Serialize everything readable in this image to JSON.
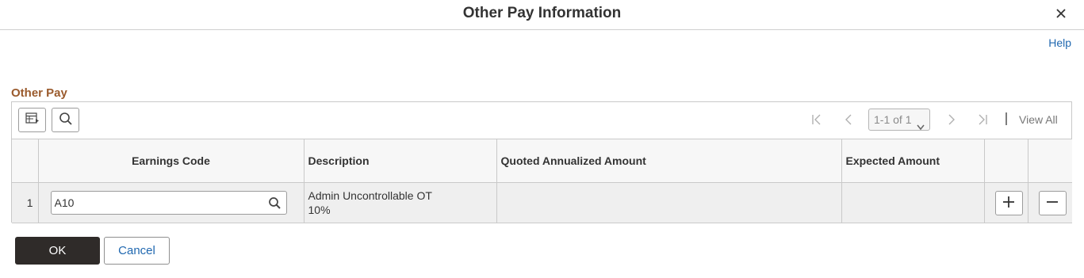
{
  "dialog": {
    "title": "Other Pay Information",
    "help_label": "Help"
  },
  "grid": {
    "title": "Other Pay",
    "pager": {
      "range_label": "1-1 of 1",
      "view_all_label": "View All"
    },
    "columns": [
      "",
      "Earnings Code",
      "Description",
      "Quoted Annualized Amount",
      "Expected Amount",
      "",
      ""
    ],
    "rows": [
      {
        "row_number": "1",
        "earnings_code": "A10",
        "description_line1": "Admin Uncontrollable OT",
        "description_line2": "10%",
        "quoted_annualized_amount": "",
        "expected_amount": ""
      }
    ]
  },
  "footer": {
    "ok_label": "OK",
    "cancel_label": "Cancel"
  },
  "colors": {
    "section_title": "#9a5a2c",
    "link": "#2068b0",
    "primary_button": "#2f2b29"
  },
  "icons": {
    "close": "close-icon",
    "grid_personalize": "grid-personalize-icon",
    "search": "search-icon",
    "first_page": "first-page-icon",
    "previous_page": "previous-page-icon",
    "next_page": "next-page-icon",
    "last_page": "last-page-icon",
    "lookup": "lookup-icon",
    "add_row": "plus-icon",
    "delete_row": "minus-icon"
  }
}
